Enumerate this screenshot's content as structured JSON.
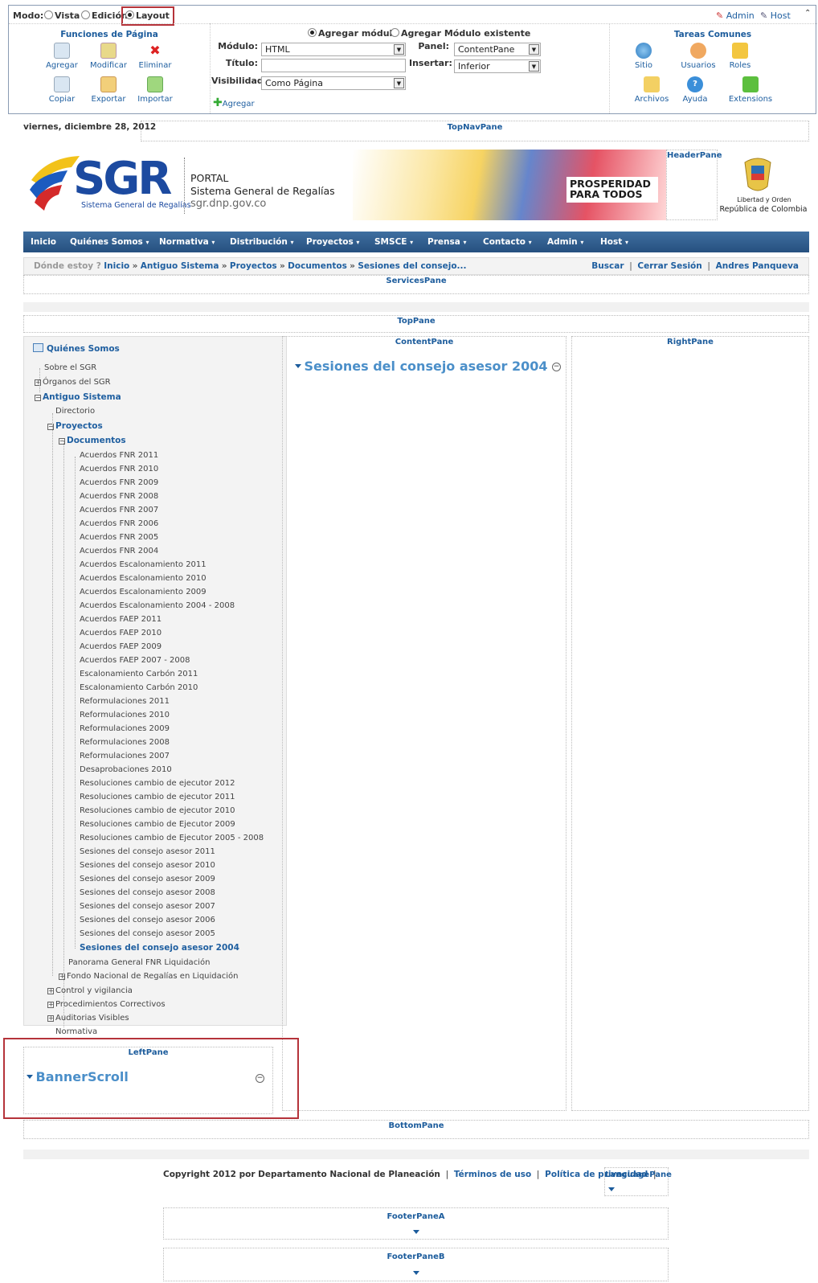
{
  "control_panel": {
    "mode_label": "Modo:",
    "modes": [
      "Vista",
      "Edición",
      "Layout"
    ],
    "selected_mode": "Layout",
    "user_links": [
      "Admin",
      "Host"
    ],
    "page_functions": {
      "title": "Funciones de Página",
      "tools": [
        "Agregar",
        "Modificar",
        "Eliminar",
        "Copiar",
        "Exportar",
        "Importar"
      ]
    },
    "add_module": {
      "option_new": "Agregar módulo",
      "option_existing": "Agregar Módulo existente",
      "module_label": "Módulo:",
      "module_value": "HTML",
      "title_label": "Título:",
      "title_value": "",
      "visibility_label": "Visibilidad:",
      "visibility_value": "Como Página",
      "pane_label": "Panel:",
      "pane_value": "ContentPane",
      "insert_label": "Insertar:",
      "insert_value": "Inferior",
      "add_button": "Agregar"
    },
    "common_tasks": {
      "title": "Tareas Comunes",
      "tools": [
        "Sitio",
        "Usuarios",
        "Roles",
        "Archivos",
        "Ayuda",
        "Extensions"
      ]
    }
  },
  "date": "viernes, diciembre 28, 2012",
  "panes": {
    "top_nav": "TopNavPane",
    "header": "HeaderPane",
    "services": "ServicesPane",
    "top": "TopPane",
    "content": "ContentPane",
    "right": "RightPane",
    "left": "LeftPane",
    "bottom": "BottomPane",
    "language": "LanguagePane",
    "footer_a": "FooterPaneA",
    "footer_b": "FooterPaneB"
  },
  "header": {
    "logo_text": "SGR",
    "logo_sub": "Sistema General de Regalías",
    "portal": "PORTAL",
    "site_name": "Sistema General de Regalías",
    "domain": "sgr.dnp.gov.co",
    "slogan_1": "PROSPERIDAD",
    "slogan_2": "PARA TODOS",
    "motto": "Libertad y Orden",
    "country": "República de Colombia"
  },
  "nav": [
    "Inicio",
    "Quiénes Somos",
    "Normativa",
    "Distribución",
    "Proyectos",
    "SMSCE",
    "Prensa",
    "Contacto",
    "Admin",
    "Host"
  ],
  "breadcrumb": {
    "prefix": "Dónde estoy ?",
    "items": [
      "Inicio",
      "Antiguo Sistema",
      "Proyectos",
      "Documentos",
      "Sesiones del consejo..."
    ],
    "links": [
      "Buscar",
      "Cerrar Sesión",
      "Andres Panqueva"
    ]
  },
  "tree": {
    "title": "Quiénes Somos",
    "items": [
      "Sobre el SGR",
      "Órganos del SGR",
      "Antiguo Sistema",
      "Directorio",
      "Proyectos",
      "Documentos",
      "Acuerdos FNR 2011",
      "Acuerdos FNR 2010",
      "Acuerdos FNR 2009",
      "Acuerdos FNR 2008",
      "Acuerdos FNR 2007",
      "Acuerdos FNR 2006",
      "Acuerdos FNR 2005",
      "Acuerdos FNR 2004",
      "Acuerdos Escalonamiento 2011",
      "Acuerdos Escalonamiento 2010",
      "Acuerdos Escalonamiento 2009",
      "Acuerdos Escalonamiento 2004 - 2008",
      "Acuerdos FAEP 2011",
      "Acuerdos FAEP 2010",
      "Acuerdos FAEP 2009",
      "Acuerdos FAEP 2007 - 2008",
      "Escalonamiento Carbón 2011",
      "Escalonamiento Carbón 2010",
      "Reformulaciones 2011",
      "Reformulaciones 2010",
      "Reformulaciones 2009",
      "Reformulaciones 2008",
      "Reformulaciones 2007",
      "Desaprobaciones 2010",
      "Resoluciones cambio de ejecutor 2012",
      "Resoluciones cambio de ejecutor 2011",
      "Resoluciones cambio de ejecutor 2010",
      "Resoluciones cambio de Ejecutor 2009",
      "Resoluciones cambio de Ejecutor 2005 - 2008",
      "Sesiones del consejo asesor 2011",
      "Sesiones del consejo asesor 2010",
      "Sesiones del consejo asesor 2009",
      "Sesiones del consejo asesor 2008",
      "Sesiones del consejo asesor 2007",
      "Sesiones del consejo asesor 2006",
      "Sesiones del consejo asesor 2005",
      "Sesiones del consejo asesor 2004",
      "Panorama General FNR Liquidación",
      "Fondo Nacional de Regalías en Liquidación",
      "Control y vigilancia",
      "Procedimientos Correctivos",
      "Auditorias Visibles",
      "Normativa"
    ]
  },
  "content_module_title": "Sesiones del consejo asesor 2004",
  "left_module_title": "BannerScroll",
  "footer": {
    "copyright": "Copyright 2012 por Departamento Nacional de Planeación",
    "terms": "Términos de uso",
    "privacy": "Política de privacidad"
  }
}
